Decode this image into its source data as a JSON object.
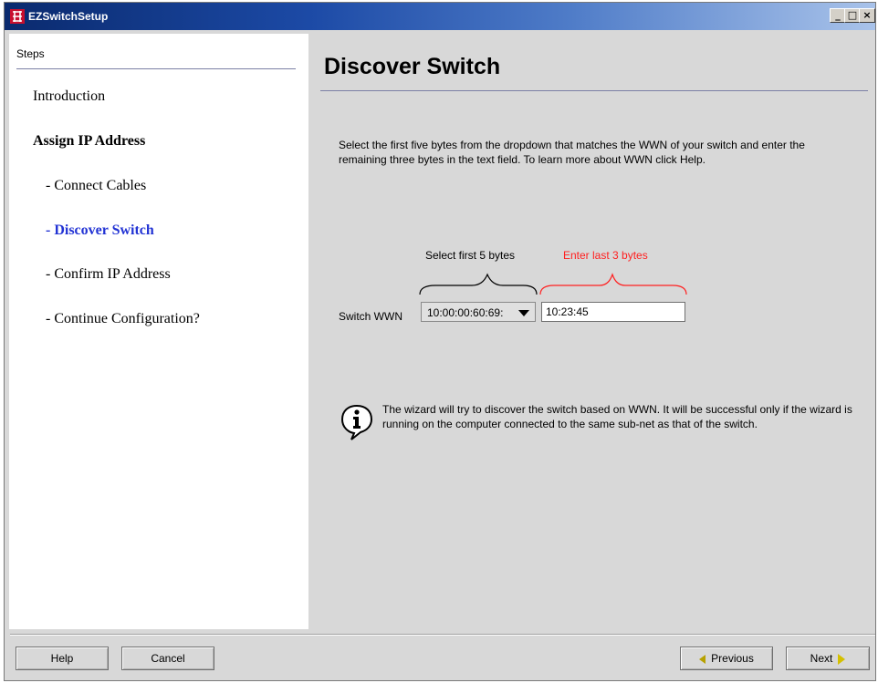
{
  "window": {
    "title": "EZSwitchSetup",
    "controls": [
      "_",
      "□",
      "×"
    ]
  },
  "steps": {
    "header": "Steps",
    "items": [
      {
        "label": "Introduction",
        "style": "normal"
      },
      {
        "label": "Assign IP Address",
        "style": "bold"
      },
      {
        "label": "- Connect Cables",
        "style": "normal"
      },
      {
        "label": "- Discover Switch",
        "style": "active"
      },
      {
        "label": "- Confirm IP Address",
        "style": "normal"
      },
      {
        "label": "- Continue Configuration?",
        "style": "normal"
      }
    ]
  },
  "content": {
    "title": "Discover Switch",
    "description": "Select the first five bytes from the dropdown that matches the WWN of your switch and enter the remaining three bytes in the text field. To learn more about WWN click Help.",
    "first_bytes_label": "Select first 5 bytes",
    "last_bytes_label": "Enter last 3 bytes",
    "wwn_label": "Switch WWN",
    "wwn_prefix_selected": "10:00:00:60:69:",
    "wwn_suffix_value": "10:23:45",
    "info_text": "The wizard will try to discover the switch based on WWN. It will be successful only if the wizard is running on the computer connected to the same sub-net as that of the switch."
  },
  "buttons": {
    "help": "Help",
    "cancel": "Cancel",
    "previous": "Previous",
    "next": "Next"
  },
  "colors": {
    "active_step": "#2233d4",
    "last_bytes_label": "#ff2020",
    "title_bar_start": "#0a2a6e",
    "title_bar_end": "#a9c3ea"
  },
  "icons": {
    "app": "switch-logo-icon",
    "info": "info-icon",
    "combo": "triangle-down-icon",
    "previous": "triangle-left-icon",
    "next": "triangle-right-icon"
  }
}
